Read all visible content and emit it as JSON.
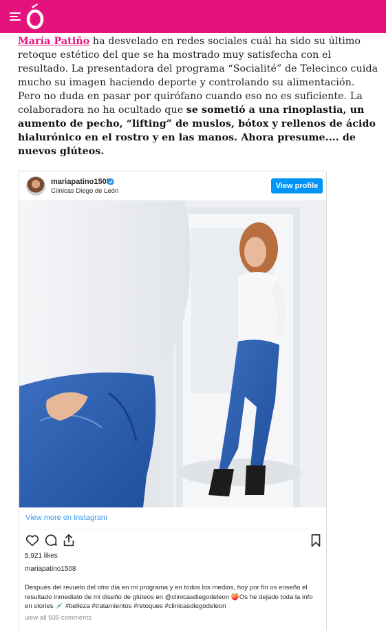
{
  "header": {
    "brand_color": "#e5127e",
    "logo_glyph": "Ó"
  },
  "article": {
    "link_name": "María Patiño",
    "text_1": " ha desvelado en redes sociales cuál ha sido su último retoque estético del que se ha mostrado muy satisfecha con el resultado. La presentadora del programa “Socialité” de Telecinco cuida mucho su imagen haciendo deporte y controlando su alimentación. Pero no duda en pasar por quirófano cuando eso no es suficiente. La colaboradora no ha ocultado que ",
    "bold_text": "se sometió a una rinoplastia, un aumento de pecho, “lifting” de muslos, bótox y rellenos de ácido hialurónico en el rostro y en las manos. Ahora presume.... de nuevos glúteos."
  },
  "instagram": {
    "username": "mariapatino1508",
    "location": "Clínicas Diego de León",
    "view_profile": "View profile",
    "view_more": "View more on Instagram",
    "likes": "5,921 likes",
    "caption_user": "mariapatino1508",
    "caption": "Después del revuelo del otro día en mi programa y en todos los medios, hoy por fin os enseño el resultado inmediato de mi diseño de glúteos en @clinicasdiegodeleon 🍑Os he dejado toda la info en stories 💉 #belleza #tratamientos #retoques #clinicasdiegodeleon",
    "comments": "view all 935 comments",
    "accent_color": "#0095f6"
  }
}
